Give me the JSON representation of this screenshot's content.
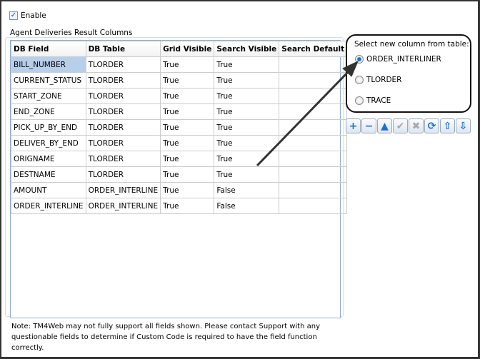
{
  "enable": {
    "label": "Enable",
    "checked": true
  },
  "group_label": "Agent Deliveries Result Columns",
  "table": {
    "headers": [
      "DB Field",
      "DB Table",
      "Grid Visible",
      "Search Visible",
      "Search Default"
    ],
    "rows": [
      [
        "BILL_NUMBER",
        "TLORDER",
        "True",
        "True",
        ""
      ],
      [
        "CURRENT_STATUS",
        "TLORDER",
        "True",
        "True",
        ""
      ],
      [
        "START_ZONE",
        "TLORDER",
        "True",
        "True",
        ""
      ],
      [
        "END_ZONE",
        "TLORDER",
        "True",
        "True",
        ""
      ],
      [
        "PICK_UP_BY_END",
        "TLORDER",
        "True",
        "True",
        ""
      ],
      [
        "DELIVER_BY_END",
        "TLORDER",
        "True",
        "True",
        ""
      ],
      [
        "ORIGNAME",
        "TLORDER",
        "True",
        "True",
        ""
      ],
      [
        "DESTNAME",
        "TLORDER",
        "True",
        "True",
        ""
      ],
      [
        "AMOUNT",
        "ORDER_INTERLINE",
        "True",
        "False",
        ""
      ],
      [
        "ORDER_INTERLINE",
        "ORDER_INTERLINE",
        "True",
        "False",
        ""
      ]
    ]
  },
  "note": "Note: TM4Web may not fully support all fields shown. Please contact Support with any questionable fields to determine if Custom Code is required to have the field function correctly.",
  "picker": {
    "label": "Select new column from table:",
    "options": [
      "ORDER_INTERLINER",
      "TLORDER",
      "TRACE"
    ],
    "selected": "ORDER_INTERLINER"
  },
  "buttons": [
    {
      "name": "add",
      "icon": "+",
      "color": "#1f6fd0"
    },
    {
      "name": "remove",
      "icon": "−",
      "color": "#1f6fd0"
    },
    {
      "name": "move-up",
      "icon": "▲",
      "color": "#1f6fd0"
    },
    {
      "name": "confirm",
      "icon": "✔",
      "color": "#aaaaaa"
    },
    {
      "name": "cancel",
      "icon": "✖",
      "color": "#aaaaaa"
    },
    {
      "name": "refresh",
      "icon": "⟳",
      "color": "#1f6fd0"
    },
    {
      "name": "move-top",
      "icon": "⇧",
      "color": "#1f6fd0"
    },
    {
      "name": "move-bottom",
      "icon": "⇩",
      "color": "#1f6fd0"
    }
  ]
}
